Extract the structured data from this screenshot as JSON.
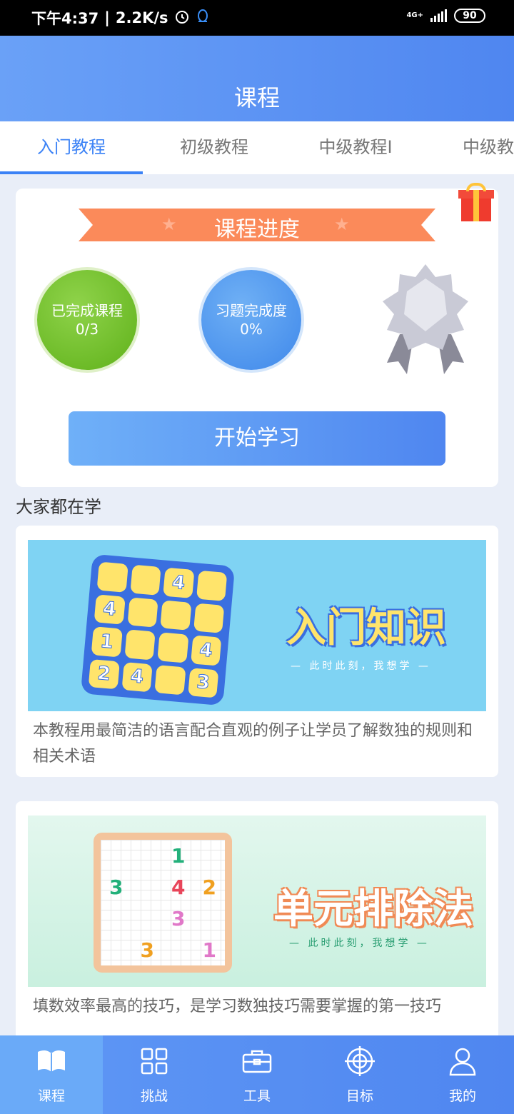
{
  "status_bar": {
    "time": "下午4:37",
    "speed": "2.2K/s",
    "network": "4G+",
    "battery": "90"
  },
  "header": {
    "title": "课程"
  },
  "tabs": [
    {
      "label": "入门教程",
      "active": true
    },
    {
      "label": "初级教程",
      "active": false
    },
    {
      "label": "中级教程I",
      "active": false
    },
    {
      "label": "中级教程",
      "active": false
    }
  ],
  "progress": {
    "ribbon_title": "课程进度",
    "completed_label": "已完成课程",
    "completed_value": "0/3",
    "exercise_label": "习题完成度",
    "exercise_value": "0%",
    "start_button": "开始学习"
  },
  "section": {
    "title": "大家都在学"
  },
  "courses": [
    {
      "banner_title": "入门知识",
      "banner_sub": "— 此时此刻，我想学 —",
      "description": "本教程用最简洁的语言配合直观的例子让学员了解数独的规则和相关术语",
      "board": [
        "",
        "",
        "4",
        "",
        "4",
        "",
        "",
        "",
        "1",
        "",
        "",
        "4",
        "2",
        "4",
        "",
        "3"
      ]
    },
    {
      "banner_title": "单元排除法",
      "banner_sub": "— 此时此刻，我想学 —",
      "description": "填数效率最高的技巧，是学习数独技巧需要掌握的第一技巧",
      "board": [
        "",
        "",
        "1",
        "",
        "3",
        "",
        "4",
        "2",
        "",
        "",
        "3",
        "",
        "",
        "3",
        "",
        "1"
      ]
    }
  ],
  "bottom_nav": [
    {
      "label": "课程",
      "icon": "book-icon",
      "active": true
    },
    {
      "label": "挑战",
      "icon": "grid-icon",
      "active": false
    },
    {
      "label": "工具",
      "icon": "toolbox-icon",
      "active": false
    },
    {
      "label": "目标",
      "icon": "target-icon",
      "active": false
    },
    {
      "label": "我的",
      "icon": "user-icon",
      "active": false
    }
  ],
  "colors": {
    "primary": "#4f86f0",
    "accent_orange": "#fb8a5a",
    "green": "#6cc024",
    "blue_circle": "#4a90ee"
  }
}
